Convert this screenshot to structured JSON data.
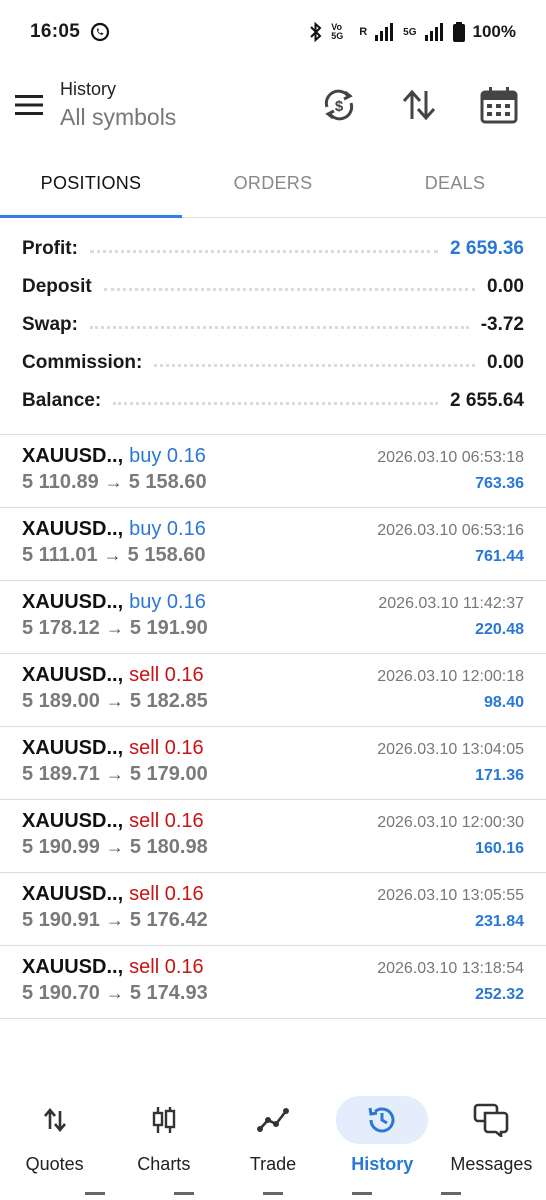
{
  "status_bar": {
    "time": "16:05",
    "volte": "Vo 5G",
    "roaming": "R",
    "network": "5G",
    "battery": "100%"
  },
  "header": {
    "title": "History",
    "subtitle": "All symbols",
    "icons": [
      "menu-icon",
      "currency-sync-icon",
      "sort-icon",
      "calendar-icon"
    ]
  },
  "tabs": [
    {
      "label": "POSITIONS",
      "active": true
    },
    {
      "label": "ORDERS",
      "active": false
    },
    {
      "label": "DEALS",
      "active": false
    }
  ],
  "summary": [
    {
      "label": "Profit:",
      "value": "2 659.36",
      "highlight": true
    },
    {
      "label": "Deposit",
      "value": "0.00",
      "highlight": false
    },
    {
      "label": "Swap:",
      "value": "-3.72",
      "highlight": false
    },
    {
      "label": "Commission:",
      "value": "0.00",
      "highlight": false
    },
    {
      "label": "Balance:",
      "value": "2 655.64",
      "highlight": false
    }
  ],
  "positions": [
    {
      "symbol": "XAUUSD..,",
      "side": "buy 0.16",
      "type": "buy",
      "open": "5 110.89",
      "arrow": "→",
      "close": "5 158.60",
      "time": "2026.03.10 06:53:18",
      "profit": "763.36"
    },
    {
      "symbol": "XAUUSD..,",
      "side": "buy 0.16",
      "type": "buy",
      "open": "5 111.01",
      "arrow": "→",
      "close": "5 158.60",
      "time": "2026.03.10 06:53:16",
      "profit": "761.44"
    },
    {
      "symbol": "XAUUSD..,",
      "side": "buy 0.16",
      "type": "buy",
      "open": "5 178.12",
      "arrow": "→",
      "close": "5 191.90",
      "time": "2026.03.10 11:42:37",
      "profit": "220.48"
    },
    {
      "symbol": "XAUUSD..,",
      "side": "sell 0.16",
      "type": "sell",
      "open": "5 189.00",
      "arrow": "→",
      "close": "5 182.85",
      "time": "2026.03.10 12:00:18",
      "profit": "98.40"
    },
    {
      "symbol": "XAUUSD..,",
      "side": "sell 0.16",
      "type": "sell",
      "open": "5 189.71",
      "arrow": "→",
      "close": "5 179.00",
      "time": "2026.03.10 13:04:05",
      "profit": "171.36"
    },
    {
      "symbol": "XAUUSD..,",
      "side": "sell 0.16",
      "type": "sell",
      "open": "5 190.99",
      "arrow": "→",
      "close": "5 180.98",
      "time": "2026.03.10 12:00:30",
      "profit": "160.16"
    },
    {
      "symbol": "XAUUSD..,",
      "side": "sell 0.16",
      "type": "sell",
      "open": "5 190.91",
      "arrow": "→",
      "close": "5 176.42",
      "time": "2026.03.10 13:05:55",
      "profit": "231.84"
    },
    {
      "symbol": "XAUUSD..,",
      "side": "sell 0.16",
      "type": "sell",
      "open": "5 190.70",
      "arrow": "→",
      "close": "5 174.93",
      "time": "2026.03.10 13:18:54",
      "profit": "252.32"
    }
  ],
  "bottom_nav": [
    {
      "label": "Quotes",
      "icon": "quotes-icon",
      "active": false
    },
    {
      "label": "Charts",
      "icon": "candlestick-icon",
      "active": false
    },
    {
      "label": "Trade",
      "icon": "trade-line-icon",
      "active": false
    },
    {
      "label": "History",
      "icon": "history-icon",
      "active": true
    },
    {
      "label": "Messages",
      "icon": "messages-icon",
      "active": false
    }
  ],
  "colors": {
    "accent": "#2a78d6",
    "sell": "#c81414",
    "muted": "#7a7a7a"
  }
}
